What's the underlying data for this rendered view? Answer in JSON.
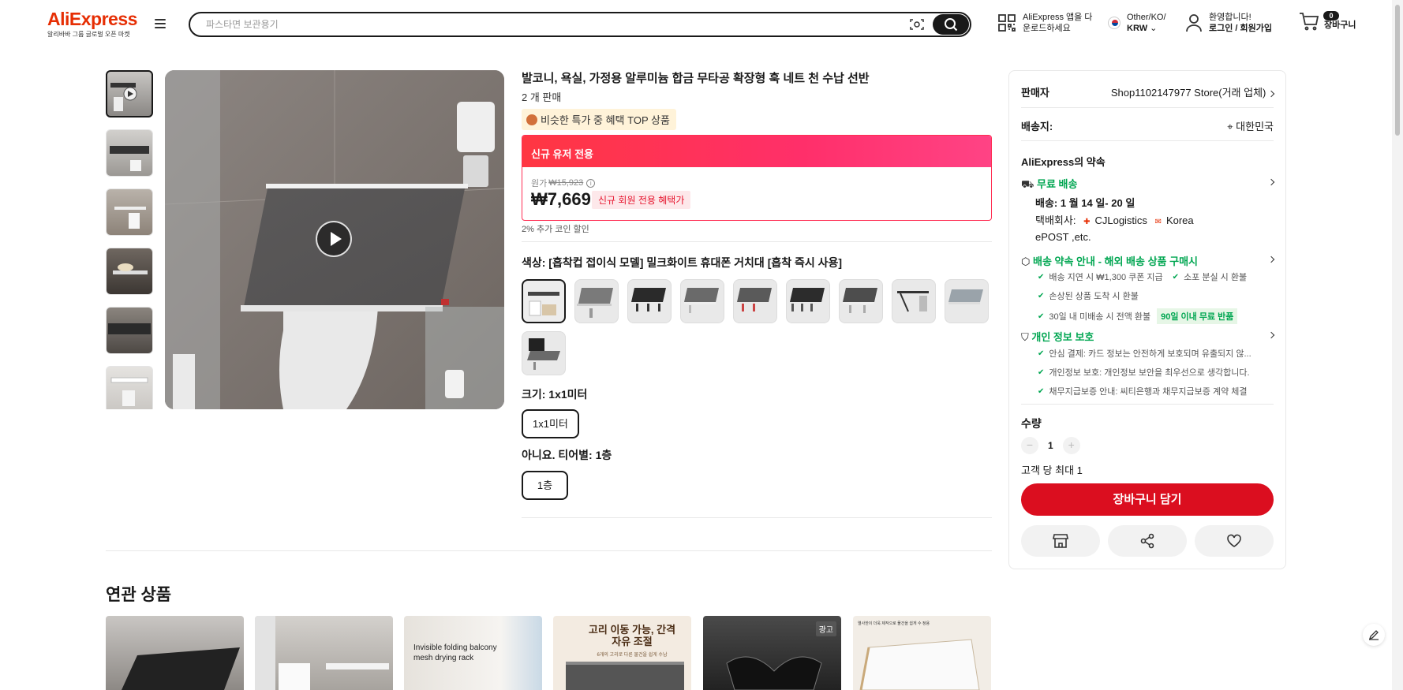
{
  "header": {
    "logo_text": "AliExpress",
    "logo_sub": "알리바바 그룹 글로벌 오픈 마켓",
    "search_placeholder": "파스타면 보관용기",
    "app_line1": "AliExpress 앱을 다",
    "app_line2": "운로드하세요",
    "lang_line1": "Other/KO/",
    "lang_line2": "KRW",
    "account_line1": "환영합니다!",
    "account_line2": "로그인 / 회원가입",
    "cart_count": "0",
    "cart_label": "장바구니"
  },
  "product": {
    "title": "발코니, 욕실, 가정용 알루미늄 합금 무타공 확장형 훅 네트 천 수납 선반",
    "sold": "2 개 판매",
    "top_tag": "비슷한 특가 중 혜택 TOP 상품",
    "promo_header": "신규 유저 전용",
    "original_label": "원가",
    "original_price": "₩15,923",
    "price": "₩7,669",
    "price_tag": "신규 회원 전용 혜택가",
    "coin_discount": "2% 추가 코인 할인",
    "color_label": "색상: [흡착컵 접이식 모델] 밀크화이트 휴대폰 거치대 [흡착 즉시 사용]",
    "size_label": "크기: 1x1미터",
    "size_option": "1x1미터",
    "tier_label": "아니요. 티어별: 1층",
    "tier_option": "1층"
  },
  "panel": {
    "seller_label": "판매자",
    "seller_name": "Shop1102147977 Store(거래 업체)",
    "ship_to_label": "배송지:",
    "ship_to_value": "대한민국",
    "promise_title": "AliExpress의 약속",
    "free_shipping": "무료 배송",
    "delivery": "배송: 1 월 14 일- 20 일",
    "carrier_label": "택배회사:",
    "carrier1": "CJLogistics",
    "carrier2": "Korea",
    "carrier3": "ePOST ,etc.",
    "delivery_guide": "배송 약속 안내 - 해외 배송 상품 구매시",
    "guide_items": [
      {
        "a": "배송 지연 시 ₩1,300 쿠폰 지급",
        "b": "소포 분실 시 환불"
      },
      {
        "a": "손상된 상품 도착 시 환불",
        "b": ""
      },
      {
        "a": "30일 내 미배송 시 전액 환불",
        "tag": "90일 이내 무료 반품"
      }
    ],
    "privacy_title": "개인 정보 보호",
    "privacy_items": [
      "안심 결제: 카드 정보는 안전하게 보호되며 유출되지 않...",
      "개인정보 보호: 개인정보 보안을 최우선으로 생각합니다.",
      "채무지급보증 안내: 씨티은행과 채무지급보증 계약 체결"
    ],
    "qty_label": "수량",
    "qty_value": "1",
    "qty_minus": "−",
    "qty_plus": "+",
    "max_per_customer": "고객 당 최대 1",
    "add_to_cart": "장바구니 담기"
  },
  "related": {
    "title": "연관 상품",
    "item3_text": "Invisible folding balcony mesh drying rack",
    "item4_text": "고리 이동 가능, 간격 자유 조절",
    "item4_sub": "6개의 고리로 다른 물건을 쉽게 수납",
    "item5_ad": "광고",
    "item6_text": "열사한이 더욱 제작으로 물건을 쉽게 수 정용"
  },
  "colors": {
    "brand_red": "#db0e1f",
    "promo_gradient_start": "#ff3642",
    "promo_gradient_end": "#ff4385",
    "green": "#00a651"
  }
}
